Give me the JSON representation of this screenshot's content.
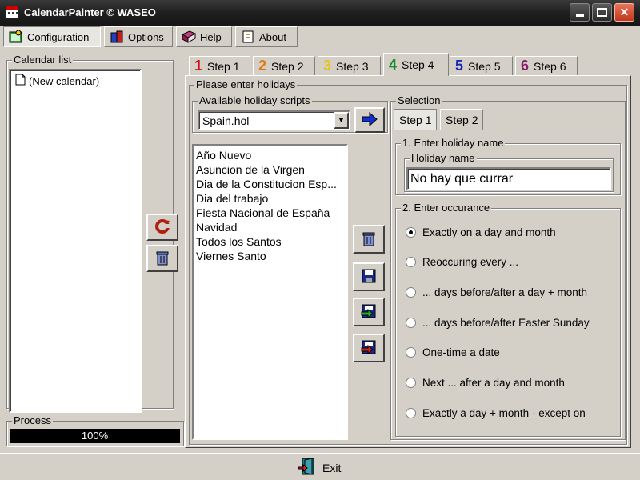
{
  "window": {
    "title": "CalendarPainter © WASEO"
  },
  "toolbar": {
    "configuration": "Configuration",
    "options": "Options",
    "help": "Help",
    "about": "About"
  },
  "calendar_list": {
    "label": "Calendar list",
    "items": [
      "(New calendar)"
    ]
  },
  "process": {
    "label": "Process",
    "progress_text": "100%",
    "progress": 1.0
  },
  "tabs": [
    {
      "num": "1",
      "label": "Step 1",
      "color": "#d01010"
    },
    {
      "num": "2",
      "label": "Step 2",
      "color": "#e07a10"
    },
    {
      "num": "3",
      "label": "Step 3",
      "color": "#e6c21a"
    },
    {
      "num": "4",
      "label": "Step 4",
      "color": "#1a8a2a"
    },
    {
      "num": "5",
      "label": "Step 5",
      "color": "#1a2ab0"
    },
    {
      "num": "6",
      "label": "Step 6",
      "color": "#8a1a6a"
    }
  ],
  "holidays": {
    "group_label": "Please enter holidays",
    "scripts_label": "Available holiday scripts",
    "selected_script": "Spain.hol",
    "items": [
      "Año Nuevo",
      "Asuncion de la Virgen",
      "Dia de la Constitucion Esp...",
      "Dia del trabajo",
      "Fiesta Nacional de España",
      "Navidad",
      "Todos los Santos",
      "Viernes Santo"
    ]
  },
  "selection": {
    "label": "Selection",
    "tabs": [
      "Step 1",
      "Step 2"
    ],
    "enter_name_label": "1. Enter holiday name",
    "holiday_name_label": "Holiday name",
    "holiday_name_value": "No hay que currar",
    "occurance_label": "2. Enter occurance",
    "options": [
      "Exactly on a day and month",
      "Reoccuring every ...",
      "... days before/after a day + month",
      "... days before/after Easter Sunday",
      "One-time a date",
      "Next ... after a day and month",
      "Exactly a day + month - except on"
    ],
    "selected_index": 0
  },
  "footer": {
    "exit": "Exit"
  }
}
